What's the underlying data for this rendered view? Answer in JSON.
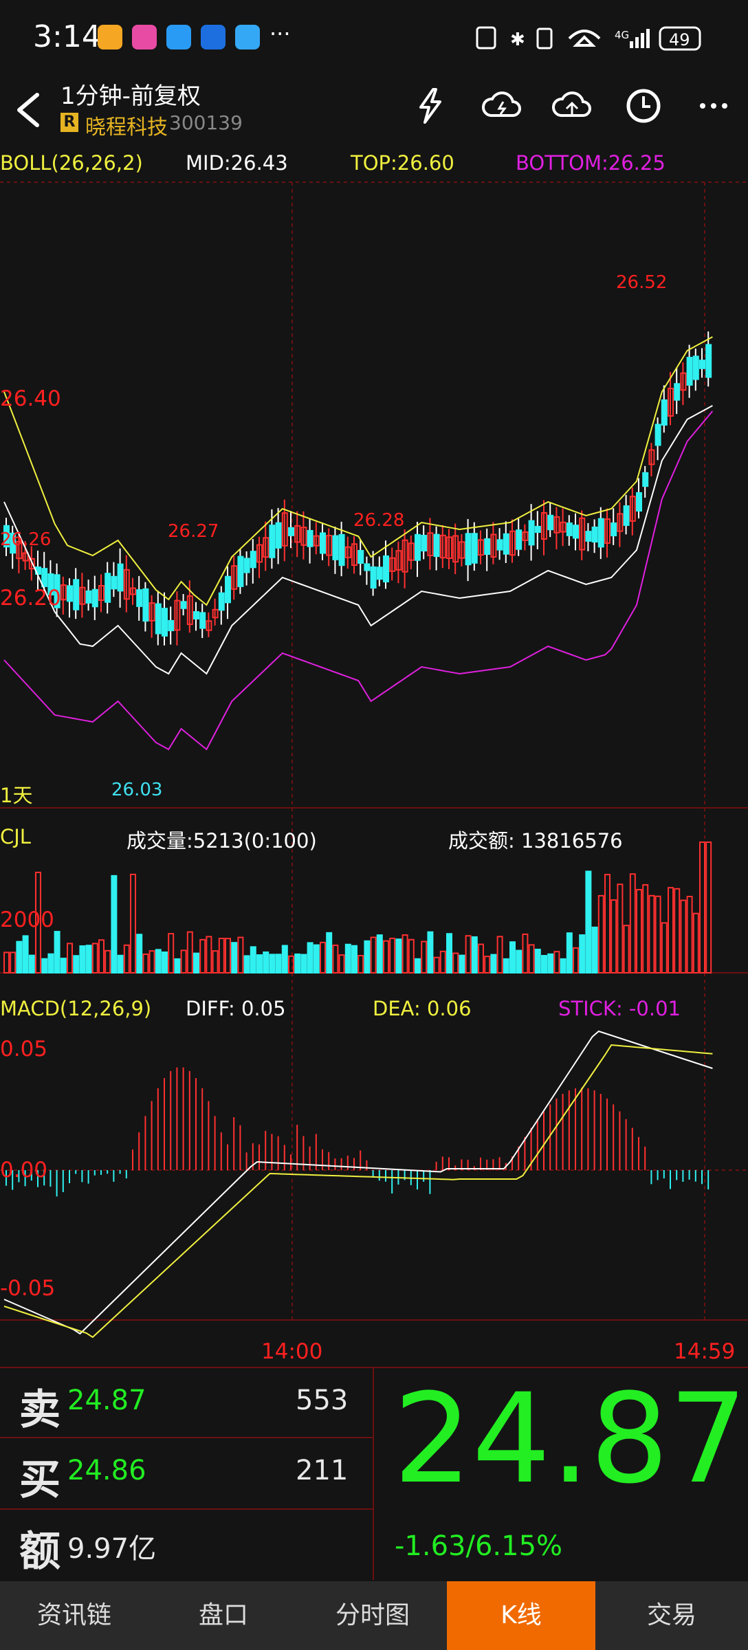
{
  "status_bar": {
    "time": "3:14",
    "battery": "49",
    "network": "4G",
    "more": "···"
  },
  "header": {
    "title": "1分钟-前复权",
    "badge": "R",
    "stock_name": "晓程科技",
    "stock_code": "300139"
  },
  "boll_indicator": {
    "name": "BOLL(26,26,2)",
    "mid": "MID:26.43",
    "top": "TOP:26.60",
    "bottom": "BOTTOM:26.25",
    "colors": {
      "name": "#f0f040",
      "mid": "#ffffff",
      "top": "#f0f040",
      "bottom": "#e020e0"
    }
  },
  "price_chart": {
    "y_labels": [
      "26.40",
      "26.20"
    ],
    "period": "1天",
    "annotations": [
      "26.27",
      "26.28",
      "26.52",
      "26.26",
      "26.03"
    ]
  },
  "volume": {
    "name": "CJL",
    "volume": "成交量:5213(0:100)",
    "amount": "成交额: 13816576",
    "y_label": "2000"
  },
  "macd": {
    "name": "MACD(12,26,9)",
    "diff": "DIFF: 0.05",
    "dea": "DEA: 0.06",
    "stick": "STICK: -0.01",
    "y_labels": [
      "0.05",
      "0.00",
      "-0.05"
    ]
  },
  "time_axis": [
    "14:00",
    "14:59"
  ],
  "quote": {
    "sell_label": "卖",
    "sell_price": "24.87",
    "sell_volume": "553",
    "buy_label": "买",
    "buy_price": "24.86",
    "buy_volume": "211",
    "amount_label": "额",
    "amount_value": "9.97亿",
    "last_price": "24.87",
    "change": "-1.63/6.15%"
  },
  "tabs": [
    {
      "label": "资讯链",
      "active": false
    },
    {
      "label": "盘口",
      "active": false
    },
    {
      "label": "分时图",
      "active": false
    },
    {
      "label": "K线",
      "active": true
    },
    {
      "label": "交易",
      "active": false
    }
  ],
  "chart_data": {
    "type": "candlestick",
    "x_axis_labels": [
      "14:00",
      "14:59"
    ],
    "price_ylabels": [
      "26.40",
      "26.20"
    ],
    "price_high": 26.52,
    "price_low": 26.03,
    "boll": {
      "mid": 26.43,
      "top": 26.6,
      "bottom": 26.25
    },
    "macd": {
      "diff": 0.05,
      "dea": 0.06,
      "stick": -0.01
    }
  }
}
